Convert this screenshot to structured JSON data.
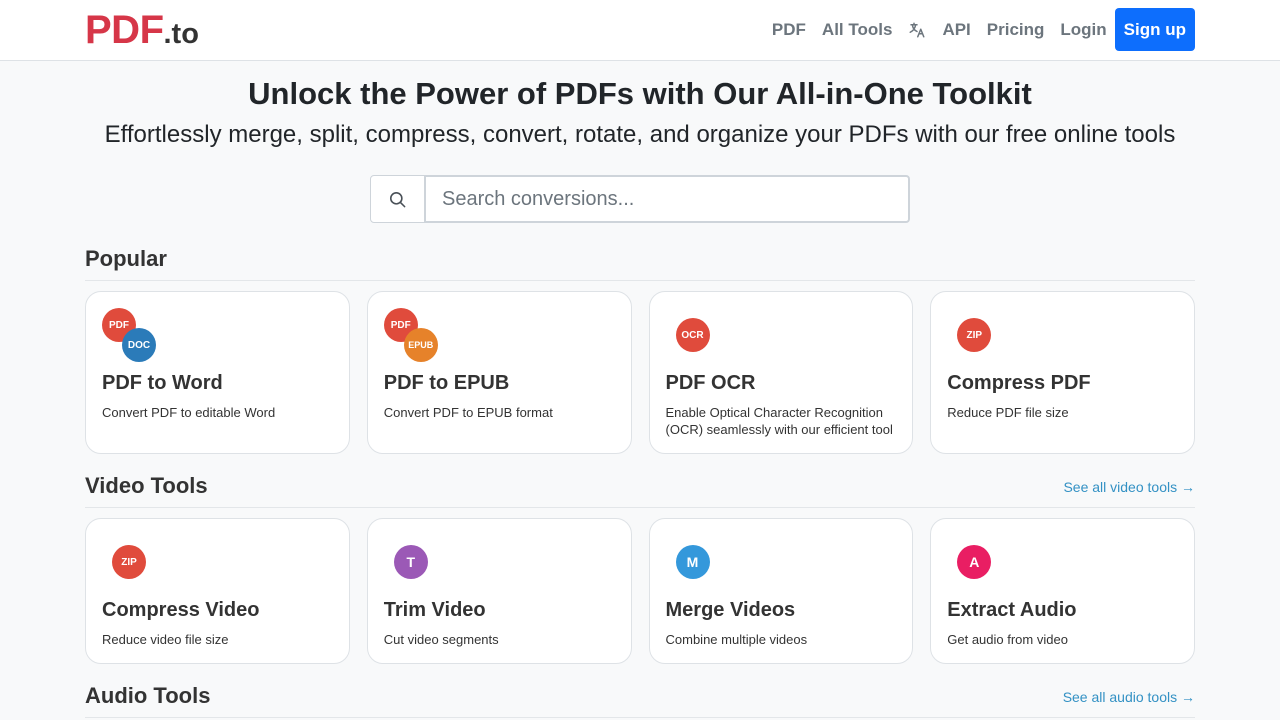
{
  "header": {
    "logo_main": "PDF",
    "logo_tld": ".to",
    "nav": {
      "pdf": "PDF",
      "all_tools": "All Tools",
      "api": "API",
      "pricing": "Pricing",
      "login": "Login",
      "signup": "Sign up"
    },
    "language_icon": "translate-icon"
  },
  "hero": {
    "title": "Unlock the Power of PDFs with Our All-in-One Toolkit",
    "subtitle": "Effortlessly merge, split, compress, convert, rotate, and organize your PDFs with our free online tools"
  },
  "search": {
    "icon": "search-icon",
    "placeholder": "Search conversions..."
  },
  "popular": {
    "title": "Popular",
    "cards": [
      {
        "title": "PDF to Word",
        "desc": "Convert PDF to editable Word",
        "badges": [
          {
            "text": "PDF",
            "color": "#e04b3c"
          },
          {
            "text": "DOC",
            "color": "#2b7bb9"
          }
        ]
      },
      {
        "title": "PDF to EPUB",
        "desc": "Convert PDF to EPUB format",
        "badges": [
          {
            "text": "PDF",
            "color": "#e04b3c"
          },
          {
            "text": "EPUB",
            "color": "#e6822a"
          }
        ]
      },
      {
        "title": "PDF OCR",
        "desc": "Enable Optical Character Recognition (OCR) seamlessly with our efficient tool",
        "badges": [
          {
            "text": "OCR",
            "color": "#e04b3c"
          }
        ]
      },
      {
        "title": "Compress PDF",
        "desc": "Reduce PDF file size",
        "badges": [
          {
            "text": "ZIP",
            "color": "#e04b3c"
          }
        ]
      }
    ]
  },
  "video": {
    "title": "Video Tools",
    "see_all": "See all video tools →",
    "cards": [
      {
        "title": "Compress Video",
        "desc": "Reduce video file size",
        "badge": {
          "text": "ZIP",
          "color": "#e04b3c"
        }
      },
      {
        "title": "Trim Video",
        "desc": "Cut video segments",
        "badge": {
          "text": "T",
          "color": "#9b59b6"
        }
      },
      {
        "title": "Merge Videos",
        "desc": "Combine multiple videos",
        "badge": {
          "text": "M",
          "color": "#3498db"
        }
      },
      {
        "title": "Extract Audio",
        "desc": "Get audio from video",
        "badge": {
          "text": "A",
          "color": "#e91e63"
        }
      }
    ]
  },
  "audio": {
    "title": "Audio Tools",
    "see_all": "See all audio tools →"
  }
}
